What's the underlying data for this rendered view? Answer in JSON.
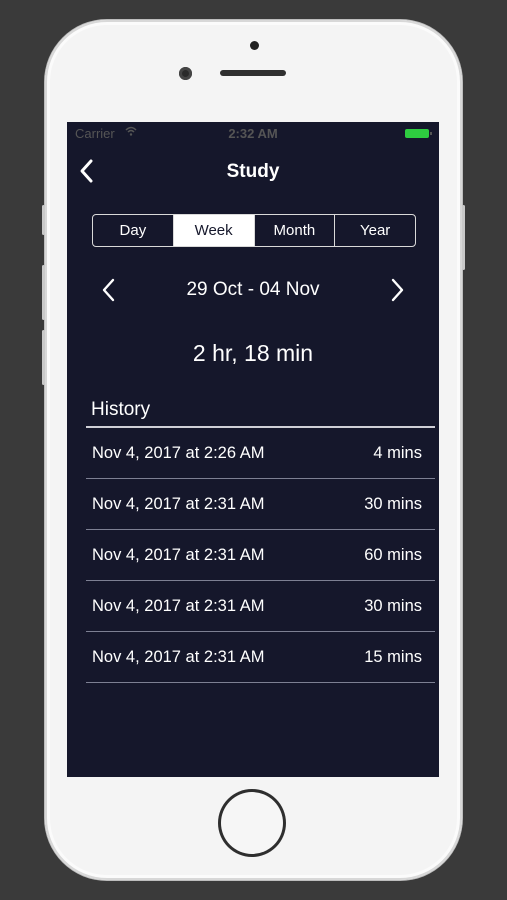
{
  "status_bar": {
    "carrier": "Carrier",
    "time": "2:32 AM"
  },
  "nav": {
    "title": "Study",
    "back_icon": "chevron-left-icon"
  },
  "segments": [
    {
      "label": "Day"
    },
    {
      "label": "Week",
      "active": true
    },
    {
      "label": "Month"
    },
    {
      "label": "Year"
    }
  ],
  "range": {
    "label": "29 Oct - 04 Nov",
    "prev_icon": "chevron-left-icon",
    "next_icon": "chevron-right-icon"
  },
  "total": "2 hr, 18 min",
  "history": {
    "header": "History",
    "rows": [
      {
        "date": "Nov 4, 2017 at 2:26 AM",
        "duration": "4 mins"
      },
      {
        "date": "Nov 4, 2017 at 2:31 AM",
        "duration": "30 mins"
      },
      {
        "date": "Nov 4, 2017 at 2:31 AM",
        "duration": "60 mins"
      },
      {
        "date": "Nov 4, 2017 at 2:31 AM",
        "duration": "30 mins"
      },
      {
        "date": "Nov 4, 2017 at 2:31 AM",
        "duration": "15 mins"
      }
    ]
  },
  "colors": {
    "background": "#15172b",
    "accent": "#ffffff",
    "battery": "#2ecc40"
  }
}
